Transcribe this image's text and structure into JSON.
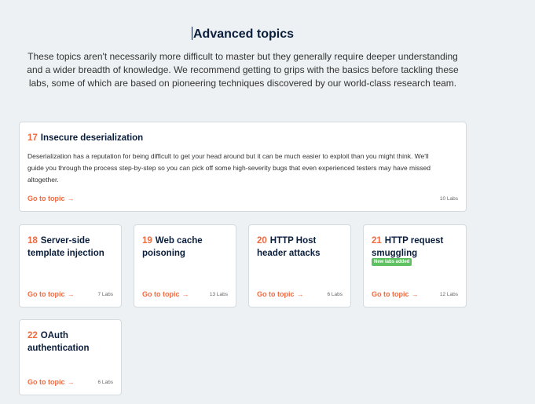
{
  "section": {
    "title": "Advanced topics",
    "intro_lines": [
      "These topics aren't necessarily more difficult to master but they generally require deeper understanding",
      "and a wider breadth of knowledge. We recommend getting to grips with the basics before tackling these",
      "labs, some of which are based on pioneering techniques discovered by our world-class research team."
    ]
  },
  "topics": [
    {
      "number": "17",
      "title": "Insecure deserialization",
      "description_lines": [
        "Deserialization has a reputation for being difficult to get your head around but it can be much easier to exploit than you might think. We'll",
        "guide you through the process step-by-step so you can pick off some high-severity bugs that even experienced testers may have missed",
        "altogether."
      ],
      "link_label": "Go to topic",
      "link_arrow": "→",
      "labs": "10 Labs"
    },
    {
      "number": "18",
      "title_lines": [
        "Server-side",
        "template injection"
      ],
      "link_label": "Go to topic",
      "link_arrow": "→",
      "labs": "7 Labs"
    },
    {
      "number": "19",
      "title_lines": [
        "Web cache",
        "poisoning"
      ],
      "link_label": "Go to topic",
      "link_arrow": "→",
      "labs": "13 Labs"
    },
    {
      "number": "20",
      "title_lines": [
        "HTTP Host",
        "header attacks"
      ],
      "link_label": "Go to topic",
      "link_arrow": "→",
      "labs": "6 Labs"
    },
    {
      "number": "21",
      "title_lines": [
        "HTTP request",
        "smuggling"
      ],
      "badge": "New labs added",
      "link_label": "Go to topic",
      "link_arrow": "→",
      "labs": "12 Labs"
    },
    {
      "number": "22",
      "title_lines": [
        "OAuth",
        "authentication"
      ],
      "link_label": "Go to topic",
      "link_arrow": "→",
      "labs": "6 Labs"
    }
  ],
  "colors": {
    "accent": "#ee6a41",
    "heading": "#0a1e3c",
    "badge": "#5cc15e",
    "background": "#edf1f3"
  }
}
